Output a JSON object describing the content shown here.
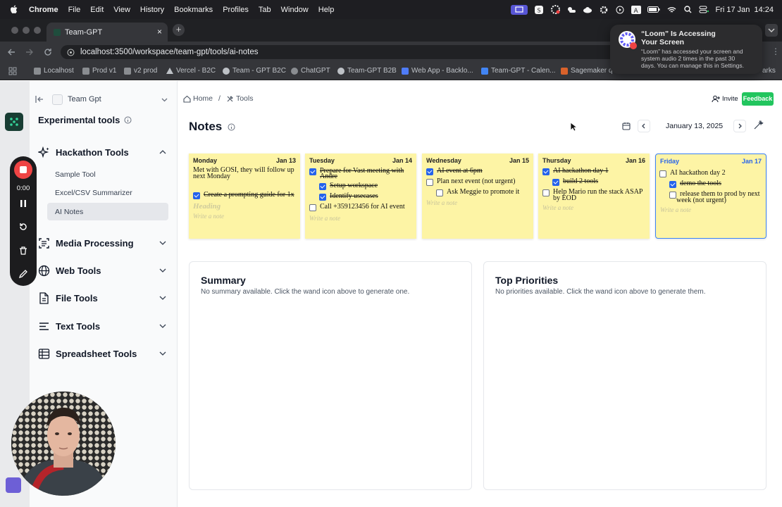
{
  "menubar": {
    "app": "Chrome",
    "items": [
      "File",
      "Edit",
      "View",
      "History",
      "Bookmarks",
      "Profiles",
      "Tab",
      "Window",
      "Help"
    ],
    "clock": "Fri 17 Jan  14:24"
  },
  "browser": {
    "tab_title": "Team-GPT",
    "url": "localhost:3500/workspace/team-gpt/tools/ai-notes",
    "bookmarks": [
      "Localhost",
      "Prod v1",
      "v2 prod",
      "Vercel - B2C",
      "Team - GPT B2C",
      "ChatGPT",
      "Team-GPT B2B",
      "Web App - Backlo...",
      "Team-GPT - Calen...",
      "Sagemaker q",
      "arks"
    ]
  },
  "notification": {
    "title_line1": "“Loom” Is Accessing",
    "title_line2": "Your Screen",
    "body_line1": "“Loom” has accessed your screen and",
    "body_line2": "system audio 2 times in the past 30",
    "body_line3": "days. You can manage this in Settings."
  },
  "recorder": {
    "time": "0:00"
  },
  "sidebar": {
    "workspace": "Team Gpt",
    "section_title": "Experimental tools",
    "groups": [
      {
        "label": "Hackathon Tools",
        "items": [
          "Sample Tool",
          "Excel/CSV Summarizer",
          "AI Notes"
        ],
        "selected": "AI Notes"
      },
      {
        "label": "Media Processing"
      },
      {
        "label": "Web Tools"
      },
      {
        "label": "File Tools"
      },
      {
        "label": "Text Tools"
      },
      {
        "label": "Spreadsheet Tools"
      }
    ]
  },
  "header": {
    "breadcrumb_home": "Home",
    "breadcrumb_sep": "/",
    "breadcrumb_tools": "Tools",
    "invite": "Invite",
    "feedback": "Feedback"
  },
  "page": {
    "title": "Notes",
    "current_date": "January 13, 2025"
  },
  "week": [
    {
      "day": "Monday",
      "date": "Jan 13",
      "line1": "Met with GOSI, they will follow up",
      "line2": "next Monday",
      "task": "Create a prompting guide for 1x",
      "heading": "Heading",
      "placeholder": "Write a note"
    },
    {
      "day": "Tuesday",
      "date": "Jan 14",
      "task1a": "Prepare for Vast meeting with",
      "task1b": "Andre",
      "sub1": "Setup workspace",
      "sub2": "Identify usecases",
      "task2": "Call +359123456 for AI event",
      "placeholder": "Write a note"
    },
    {
      "day": "Wednesday",
      "date": "Jan 15",
      "task1": "AI event at 6pm",
      "task2": "Plan next event (not urgent)",
      "sub1": "Ask Meggie to promote it",
      "placeholder": "Write a note"
    },
    {
      "day": "Thursday",
      "date": "Jan 16",
      "task1": "AI hackathon day 1",
      "sub1": "build 2 tools",
      "task2a": "Help Mario run the stack ASAP",
      "task2b": "by EOD",
      "placeholder": "Write a note"
    },
    {
      "day": "Friday",
      "date": "Jan 17",
      "task1": "AI hackathon day 2",
      "sub1": "demo the tools",
      "sub2a": "release them to prod by next",
      "sub2b": "week (not urgent)",
      "placeholder": "Write a note"
    }
  ],
  "summary": {
    "title": "Summary",
    "empty": "No summary available. Click the wand icon above to generate one."
  },
  "priorities": {
    "title": "Top Priorities",
    "empty": "No priorities available. Click the wand icon above to generate them."
  },
  "colors": {
    "note_bg": "#fdf4a5",
    "checkbox": "#2563eb",
    "feedback": "#22c55e",
    "record": "#ef4444"
  }
}
